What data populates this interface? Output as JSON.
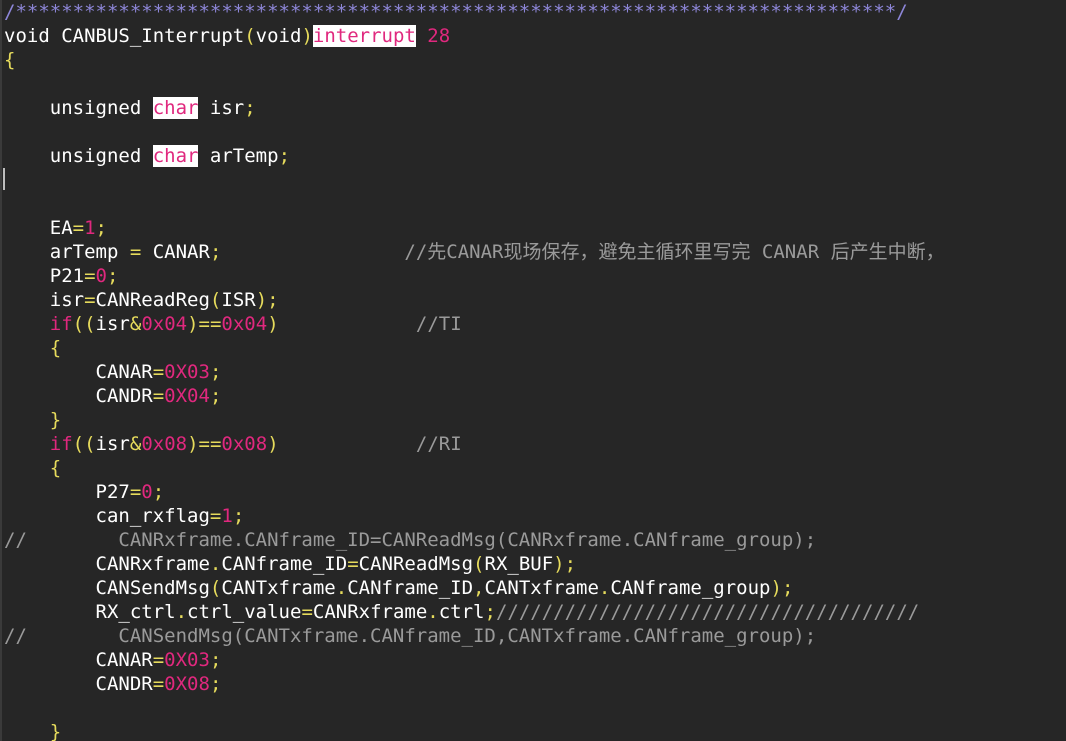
{
  "window": {
    "title": ""
  },
  "editor": {
    "colors": {
      "background": "#262626",
      "text": "#ffffff",
      "punctuation": "#e6db5c",
      "number": "#e0287e",
      "block_comment": "#8d86d8",
      "line_comment": "#9a9a9a",
      "keyword_highlight_bg": "#ffffff"
    },
    "lines": [
      [
        [
          "cmtblk",
          "/*****************************************************************************/"
        ]
      ],
      [
        [
          "plain",
          "void CANBUS_Interrupt"
        ],
        [
          "punct",
          "("
        ],
        [
          "plain",
          "void"
        ],
        [
          "punct",
          ")"
        ],
        [
          "hl",
          "interrupt"
        ],
        [
          "plain",
          " "
        ],
        [
          "num",
          "28"
        ]
      ],
      [
        [
          "punct",
          "{"
        ]
      ],
      [],
      [
        [
          "plain",
          "    unsigned "
        ],
        [
          "hl",
          "char"
        ],
        [
          "plain",
          " isr"
        ],
        [
          "punct",
          ";"
        ]
      ],
      [],
      [
        [
          "plain",
          "    unsigned "
        ],
        [
          "hl",
          "char"
        ],
        [
          "plain",
          " arTemp"
        ],
        [
          "punct",
          ";"
        ]
      ],
      [],
      [],
      [
        [
          "plain",
          "    EA"
        ],
        [
          "punct",
          "="
        ],
        [
          "num",
          "1"
        ],
        [
          "punct",
          ";"
        ]
      ],
      [
        [
          "plain",
          "    arTemp "
        ],
        [
          "punct",
          "="
        ],
        [
          "plain",
          " CANAR"
        ],
        [
          "punct",
          ";"
        ],
        [
          "plain",
          "                "
        ],
        [
          "cmt",
          "//先CANAR现场保存，避免主循环里写完 CANAR 后产生中断，"
        ]
      ],
      [
        [
          "plain",
          "    P21"
        ],
        [
          "punct",
          "="
        ],
        [
          "num",
          "0"
        ],
        [
          "punct",
          ";"
        ]
      ],
      [
        [
          "plain",
          "    isr"
        ],
        [
          "punct",
          "="
        ],
        [
          "plain",
          "CANReadReg"
        ],
        [
          "punct",
          "("
        ],
        [
          "plain",
          "ISR"
        ],
        [
          "punct",
          ");"
        ]
      ],
      [
        [
          "plain",
          "    "
        ],
        [
          "num",
          "if"
        ],
        [
          "punct",
          "(("
        ],
        [
          "plain",
          "isr"
        ],
        [
          "punct",
          "&"
        ],
        [
          "num",
          "0x04"
        ],
        [
          "punct",
          ")=="
        ],
        [
          "num",
          "0x04"
        ],
        [
          "punct",
          ")"
        ],
        [
          "plain",
          "            "
        ],
        [
          "cmt",
          "//TI"
        ]
      ],
      [
        [
          "plain",
          "    "
        ],
        [
          "punct",
          "{"
        ]
      ],
      [
        [
          "plain",
          "        CANAR"
        ],
        [
          "punct",
          "="
        ],
        [
          "num",
          "0X03"
        ],
        [
          "punct",
          ";"
        ]
      ],
      [
        [
          "plain",
          "        CANDR"
        ],
        [
          "punct",
          "="
        ],
        [
          "num",
          "0X04"
        ],
        [
          "punct",
          ";"
        ]
      ],
      [
        [
          "plain",
          "    "
        ],
        [
          "punct",
          "}"
        ]
      ],
      [
        [
          "plain",
          "    "
        ],
        [
          "num",
          "if"
        ],
        [
          "punct",
          "(("
        ],
        [
          "plain",
          "isr"
        ],
        [
          "punct",
          "&"
        ],
        [
          "num",
          "0x08"
        ],
        [
          "punct",
          ")=="
        ],
        [
          "num",
          "0x08"
        ],
        [
          "punct",
          ")"
        ],
        [
          "plain",
          "            "
        ],
        [
          "cmt",
          "//RI"
        ]
      ],
      [
        [
          "plain",
          "    "
        ],
        [
          "punct",
          "{"
        ]
      ],
      [
        [
          "plain",
          "        P27"
        ],
        [
          "punct",
          "="
        ],
        [
          "num",
          "0"
        ],
        [
          "punct",
          ";"
        ]
      ],
      [
        [
          "plain",
          "        can_rxflag"
        ],
        [
          "punct",
          "="
        ],
        [
          "num",
          "1"
        ],
        [
          "punct",
          ";"
        ]
      ],
      [
        [
          "cmt",
          "//        CANRxframe.CANframe_ID=CANReadMsg(CANRxframe.CANframe_group);"
        ]
      ],
      [
        [
          "plain",
          "        CANRxframe"
        ],
        [
          "punct",
          "."
        ],
        [
          "plain",
          "CANframe_ID"
        ],
        [
          "punct",
          "="
        ],
        [
          "plain",
          "CANReadMsg"
        ],
        [
          "punct",
          "("
        ],
        [
          "plain",
          "RX_BUF"
        ],
        [
          "punct",
          ");"
        ]
      ],
      [
        [
          "plain",
          "        CANSendMsg"
        ],
        [
          "punct",
          "("
        ],
        [
          "plain",
          "CANTxframe"
        ],
        [
          "punct",
          "."
        ],
        [
          "plain",
          "CANframe_ID"
        ],
        [
          "punct",
          ","
        ],
        [
          "plain",
          "CANTxframe"
        ],
        [
          "punct",
          "."
        ],
        [
          "plain",
          "CANframe_group"
        ],
        [
          "punct",
          ");"
        ]
      ],
      [
        [
          "plain",
          "        RX_ctrl"
        ],
        [
          "punct",
          "."
        ],
        [
          "plain",
          "ctrl_value"
        ],
        [
          "punct",
          "="
        ],
        [
          "plain",
          "CANRxframe"
        ],
        [
          "punct",
          "."
        ],
        [
          "plain",
          "ctrl"
        ],
        [
          "punct",
          ";"
        ],
        [
          "cmt",
          "/////////////////////////////////////"
        ]
      ],
      [
        [
          "cmt",
          "//        CANSendMsg(CANTxframe.CANframe_ID,CANTxframe.CANframe_group);"
        ]
      ],
      [
        [
          "plain",
          "        CANAR"
        ],
        [
          "punct",
          "="
        ],
        [
          "num",
          "0X03"
        ],
        [
          "punct",
          ";"
        ]
      ],
      [
        [
          "plain",
          "        CANDR"
        ],
        [
          "punct",
          "="
        ],
        [
          "num",
          "0X08"
        ],
        [
          "punct",
          ";"
        ]
      ],
      [],
      [
        [
          "plain",
          "    "
        ],
        [
          "punct",
          "}"
        ]
      ]
    ]
  }
}
